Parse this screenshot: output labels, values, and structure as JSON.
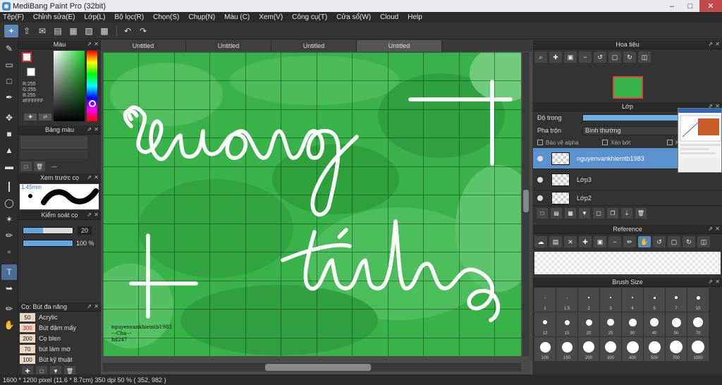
{
  "window": {
    "title": "MediBang Paint Pro (32bit)"
  },
  "menu": [
    "Tệp(F)",
    "Chỉnh sửa(E)",
    "Lớp(L)",
    "Bộ lọc(R)",
    "Chọn(S)",
    "Chụp(N)",
    "Màu (C)",
    "Xem(V)",
    "Công cụ(T)",
    "Cửa sổ(W)",
    "Cloud",
    "Help"
  ],
  "tabs": [
    "Untitled",
    "Untitled",
    "Untitled",
    "Untitled"
  ],
  "active_tab_index": 3,
  "panels": {
    "color": {
      "title": "Màu",
      "rgb": [
        "R:255",
        "G:255",
        "B:255",
        "#FFFFFF"
      ],
      "fg_color": "#e23030",
      "bg_color": "#ffffff"
    },
    "palette": {
      "title": "Bảng màu",
      "dash": "---"
    },
    "brush_preview": {
      "title": "Xem trước cọ",
      "size": "1.45mm"
    },
    "brush_control": {
      "title": "Kiểm soát cọ",
      "size_value": "20",
      "opacity_value": "100 %",
      "size_fraction": 0.4,
      "opacity_fraction": 1.0
    },
    "brush_list": {
      "title": "Cọ: Bút đa năng",
      "items": [
        {
          "num": "50",
          "name": "Acrylic",
          "highlight": false
        },
        {
          "num": "300",
          "name": "Bút đậm mấy",
          "highlight": true
        },
        {
          "num": "200",
          "name": "Cọ blen",
          "highlight": false
        },
        {
          "num": "70",
          "name": "bút làm mờ",
          "highlight": false
        },
        {
          "num": "100",
          "name": "Bút kỹ thuật",
          "highlight": false
        }
      ]
    },
    "navigator": {
      "title": "Hoa tiêu"
    },
    "layer": {
      "title": "Lớp",
      "opacity_label": "Độ trong",
      "blend_label": "Pha trộn",
      "blend_value": "Bình thường",
      "protect_alpha": "Bảo vệ alpha",
      "clipping": "Xén bớt",
      "lock": "Kh",
      "layers": [
        {
          "name": "nguyenvankhiemtb1983",
          "selected": true
        },
        {
          "name": "Lớp3",
          "selected": false
        },
        {
          "name": "Lớp2",
          "selected": false
        }
      ]
    },
    "reference": {
      "title": "Reference"
    },
    "brush_size": {
      "title": "Brush Size",
      "sizes": [
        "1",
        "1.5",
        "2",
        "3",
        "4",
        "5",
        "7",
        "10",
        "12",
        "15",
        "20",
        "25",
        "30",
        "40",
        "50",
        "70",
        "100",
        "150",
        "200",
        "300",
        "400",
        "500",
        "700",
        "1000"
      ]
    }
  },
  "canvas": {
    "text_line1": "dương",
    "text_line2": "tính",
    "watermark": [
      "nguyenvankhiemtb1983",
      "---Cha---",
      "hd247"
    ],
    "background_color": "#3ab24a"
  },
  "status": {
    "size": "1600 * 1200 pixel",
    "physical": "(11.6 * 8.7cm)",
    "dpi": "350 dpi",
    "zoom": "50 %",
    "coords": "( 352, 982 )"
  },
  "icons": {
    "toolbar": [
      "wand-icon",
      "export-icon",
      "chat-icon",
      "comment-icon",
      "page-icon",
      "grid-icon",
      "tiles-icon",
      "undo-icon",
      "redo-icon"
    ],
    "tools": [
      "brush-icon",
      "eraser-icon",
      "rect-select-icon",
      "pen-icon",
      "move-icon",
      "fill-rect-icon",
      "bucket-icon",
      "gradient-icon",
      "marquee-icon",
      "lasso-icon",
      "magic-wand-icon",
      "select-pen-icon",
      "select-eraser-icon",
      "text-icon",
      "operation-icon",
      "eyedropper-icon",
      "hand-icon"
    ]
  }
}
